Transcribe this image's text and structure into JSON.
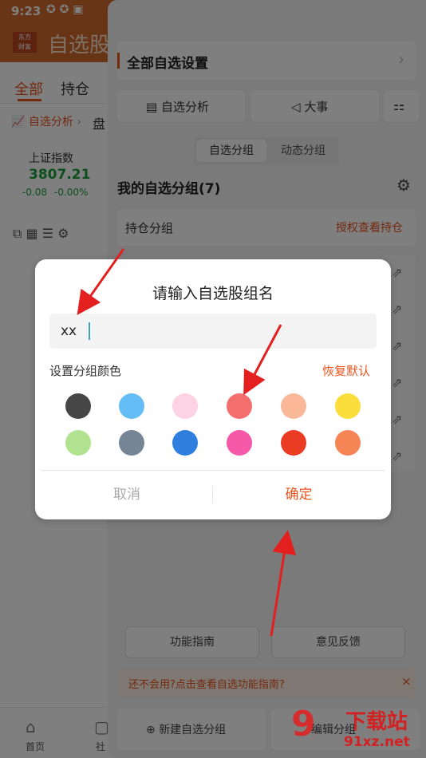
{
  "status_bar": {
    "time": "9:23"
  },
  "back_app": {
    "logo_text": "东方\n财富",
    "title": "自选股",
    "tabs": [
      "全部",
      "持仓"
    ],
    "analysis_label": "自选分析",
    "breadcrumb_next": "盘",
    "index_name": "上证指数",
    "index_value": "3807.21",
    "index_change": "-0.08",
    "index_change_pct": "-0.00%",
    "bottom_nav": [
      "首页",
      "社"
    ]
  },
  "drawer": {
    "settings_title": "全部自选设置",
    "btn_analysis": "自选分析",
    "btn_events": "大事",
    "segment": [
      "自选分组",
      "动态分组"
    ],
    "my_groups_title": "我的自选分组(7)",
    "holdings_group": "持仓分组",
    "holdings_link": "授权查看持仓",
    "guide_button": "功能指南",
    "feedback_button": "意见反馈",
    "hint_text": "还不会用?点击查看自选功能指南?",
    "new_group_button": "新建自选分组",
    "edit_group_button": "编辑分组"
  },
  "dialog": {
    "title": "请输入自选股组名",
    "input_value": "xx",
    "color_label": "设置分组颜色",
    "restore_default": "恢复默认",
    "colors": [
      "#464646",
      "#65bdf6",
      "#fdd2e3",
      "#f46e6d",
      "#fbb898",
      "#fadd3b",
      "#b1e28f",
      "#768596",
      "#2f7fe0",
      "#f659a8",
      "#ea3b23",
      "#f58554"
    ],
    "cancel": "取消",
    "confirm": "确定"
  },
  "watermark": {
    "brand": "下载站",
    "url": "91xz.net"
  },
  "colors": {
    "accent": "#e8541e",
    "drawer_bg": "#f5f5f5",
    "dialog_bg": "#ffffff",
    "arrow": "#e41f1f"
  }
}
